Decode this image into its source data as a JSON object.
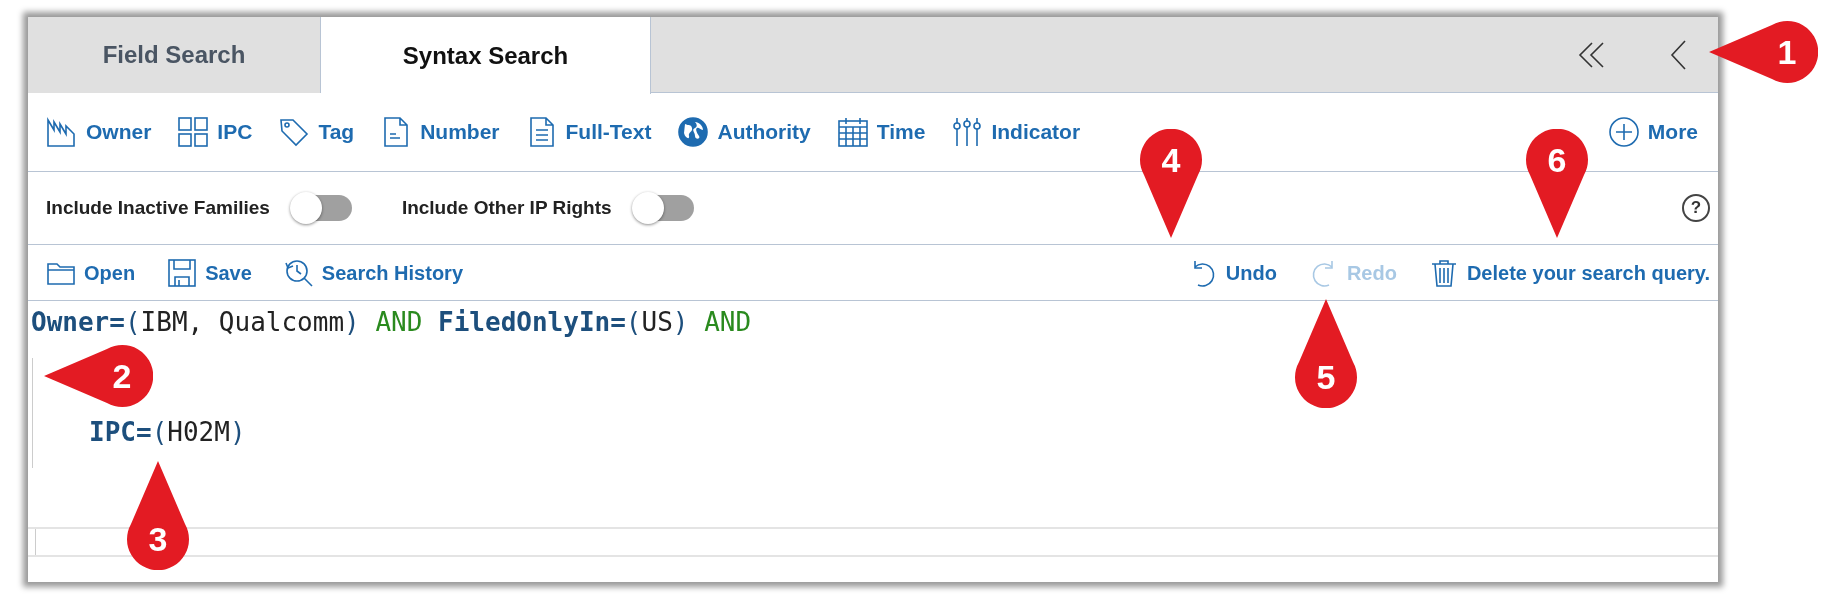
{
  "tabs": [
    {
      "label": "Field Search",
      "selected": false
    },
    {
      "label": "Syntax Search",
      "selected": true
    }
  ],
  "toolbar": [
    {
      "label": "Owner"
    },
    {
      "label": "IPC"
    },
    {
      "label": "Tag"
    },
    {
      "label": "Number"
    },
    {
      "label": "Full-Text"
    },
    {
      "label": "Authority"
    },
    {
      "label": "Time"
    },
    {
      "label": "Indicator"
    }
  ],
  "more_button": {
    "label": "More"
  },
  "toggles": [
    {
      "label": "Include Inactive Families",
      "on": false
    },
    {
      "label": "Include Other IP Rights",
      "on": false
    }
  ],
  "help": {
    "label": "?"
  },
  "actions_left": [
    {
      "label": "Open"
    },
    {
      "label": "Save"
    },
    {
      "label": "Search History"
    }
  ],
  "actions_right": [
    {
      "label": "Undo",
      "disabled": false
    },
    {
      "label": "Redo",
      "disabled": true
    },
    {
      "label": "Delete your search query.",
      "disabled": false
    }
  ],
  "editor": {
    "lines": [
      {
        "indented": false,
        "tokens": [
          {
            "kind": "field",
            "text": "Owner="
          },
          {
            "kind": "paren",
            "text": "("
          },
          {
            "kind": "value",
            "text": "IBM, Qualcomm"
          },
          {
            "kind": "paren",
            "text": ")"
          },
          {
            "kind": "operator",
            "text": "AND"
          },
          {
            "kind": "field",
            "text": "FiledOnlyIn="
          },
          {
            "kind": "paren",
            "text": "("
          },
          {
            "kind": "value",
            "text": "US"
          },
          {
            "kind": "paren",
            "text": ")"
          },
          {
            "kind": "operator",
            "text": "AND"
          }
        ]
      },
      {
        "indented": true
      },
      {
        "indented": true,
        "tokens": [
          {
            "kind": "field",
            "text": "IPC="
          },
          {
            "kind": "paren",
            "text": "("
          },
          {
            "kind": "value",
            "text": "H02M"
          },
          {
            "kind": "paren",
            "text": ")"
          }
        ]
      },
      {
        "indented": false
      },
      {
        "indented": false,
        "current": true
      }
    ]
  },
  "callouts": [
    {
      "label": "1",
      "kind": "left"
    },
    {
      "label": "2",
      "kind": "left"
    },
    {
      "label": "3",
      "kind": "up"
    },
    {
      "label": "4",
      "kind": "down"
    },
    {
      "label": "5",
      "kind": "up"
    },
    {
      "label": "6",
      "kind": "down"
    }
  ]
}
